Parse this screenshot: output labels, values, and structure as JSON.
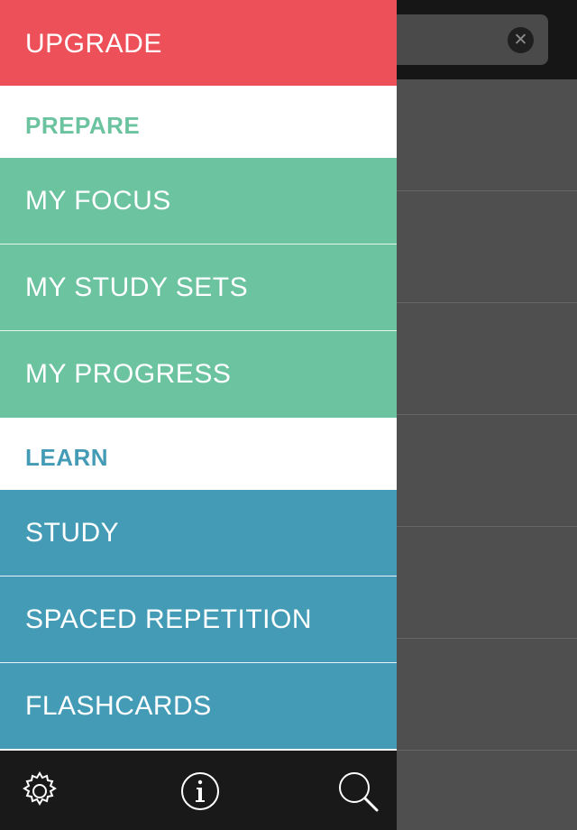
{
  "drawer": {
    "upgrade_label": "UPGRADE",
    "prepare_heading": "PREPARE",
    "prepare_items": [
      "MY FOCUS",
      "MY STUDY SETS",
      "MY PROGRESS"
    ],
    "learn_heading": "LEARN",
    "learn_items": [
      "STUDY",
      "SPACED REPETITION",
      "FLASHCARDS"
    ]
  },
  "bottom_bar": {
    "icons": [
      "gear-icon",
      "info-icon",
      "search-icon"
    ]
  },
  "background": {
    "clear_glyph": "✕"
  },
  "colors": {
    "upgrade": "#ee5059",
    "prepare": "#6cc3a0",
    "learn": "#449bb6",
    "bottom_bar": "#191919"
  }
}
